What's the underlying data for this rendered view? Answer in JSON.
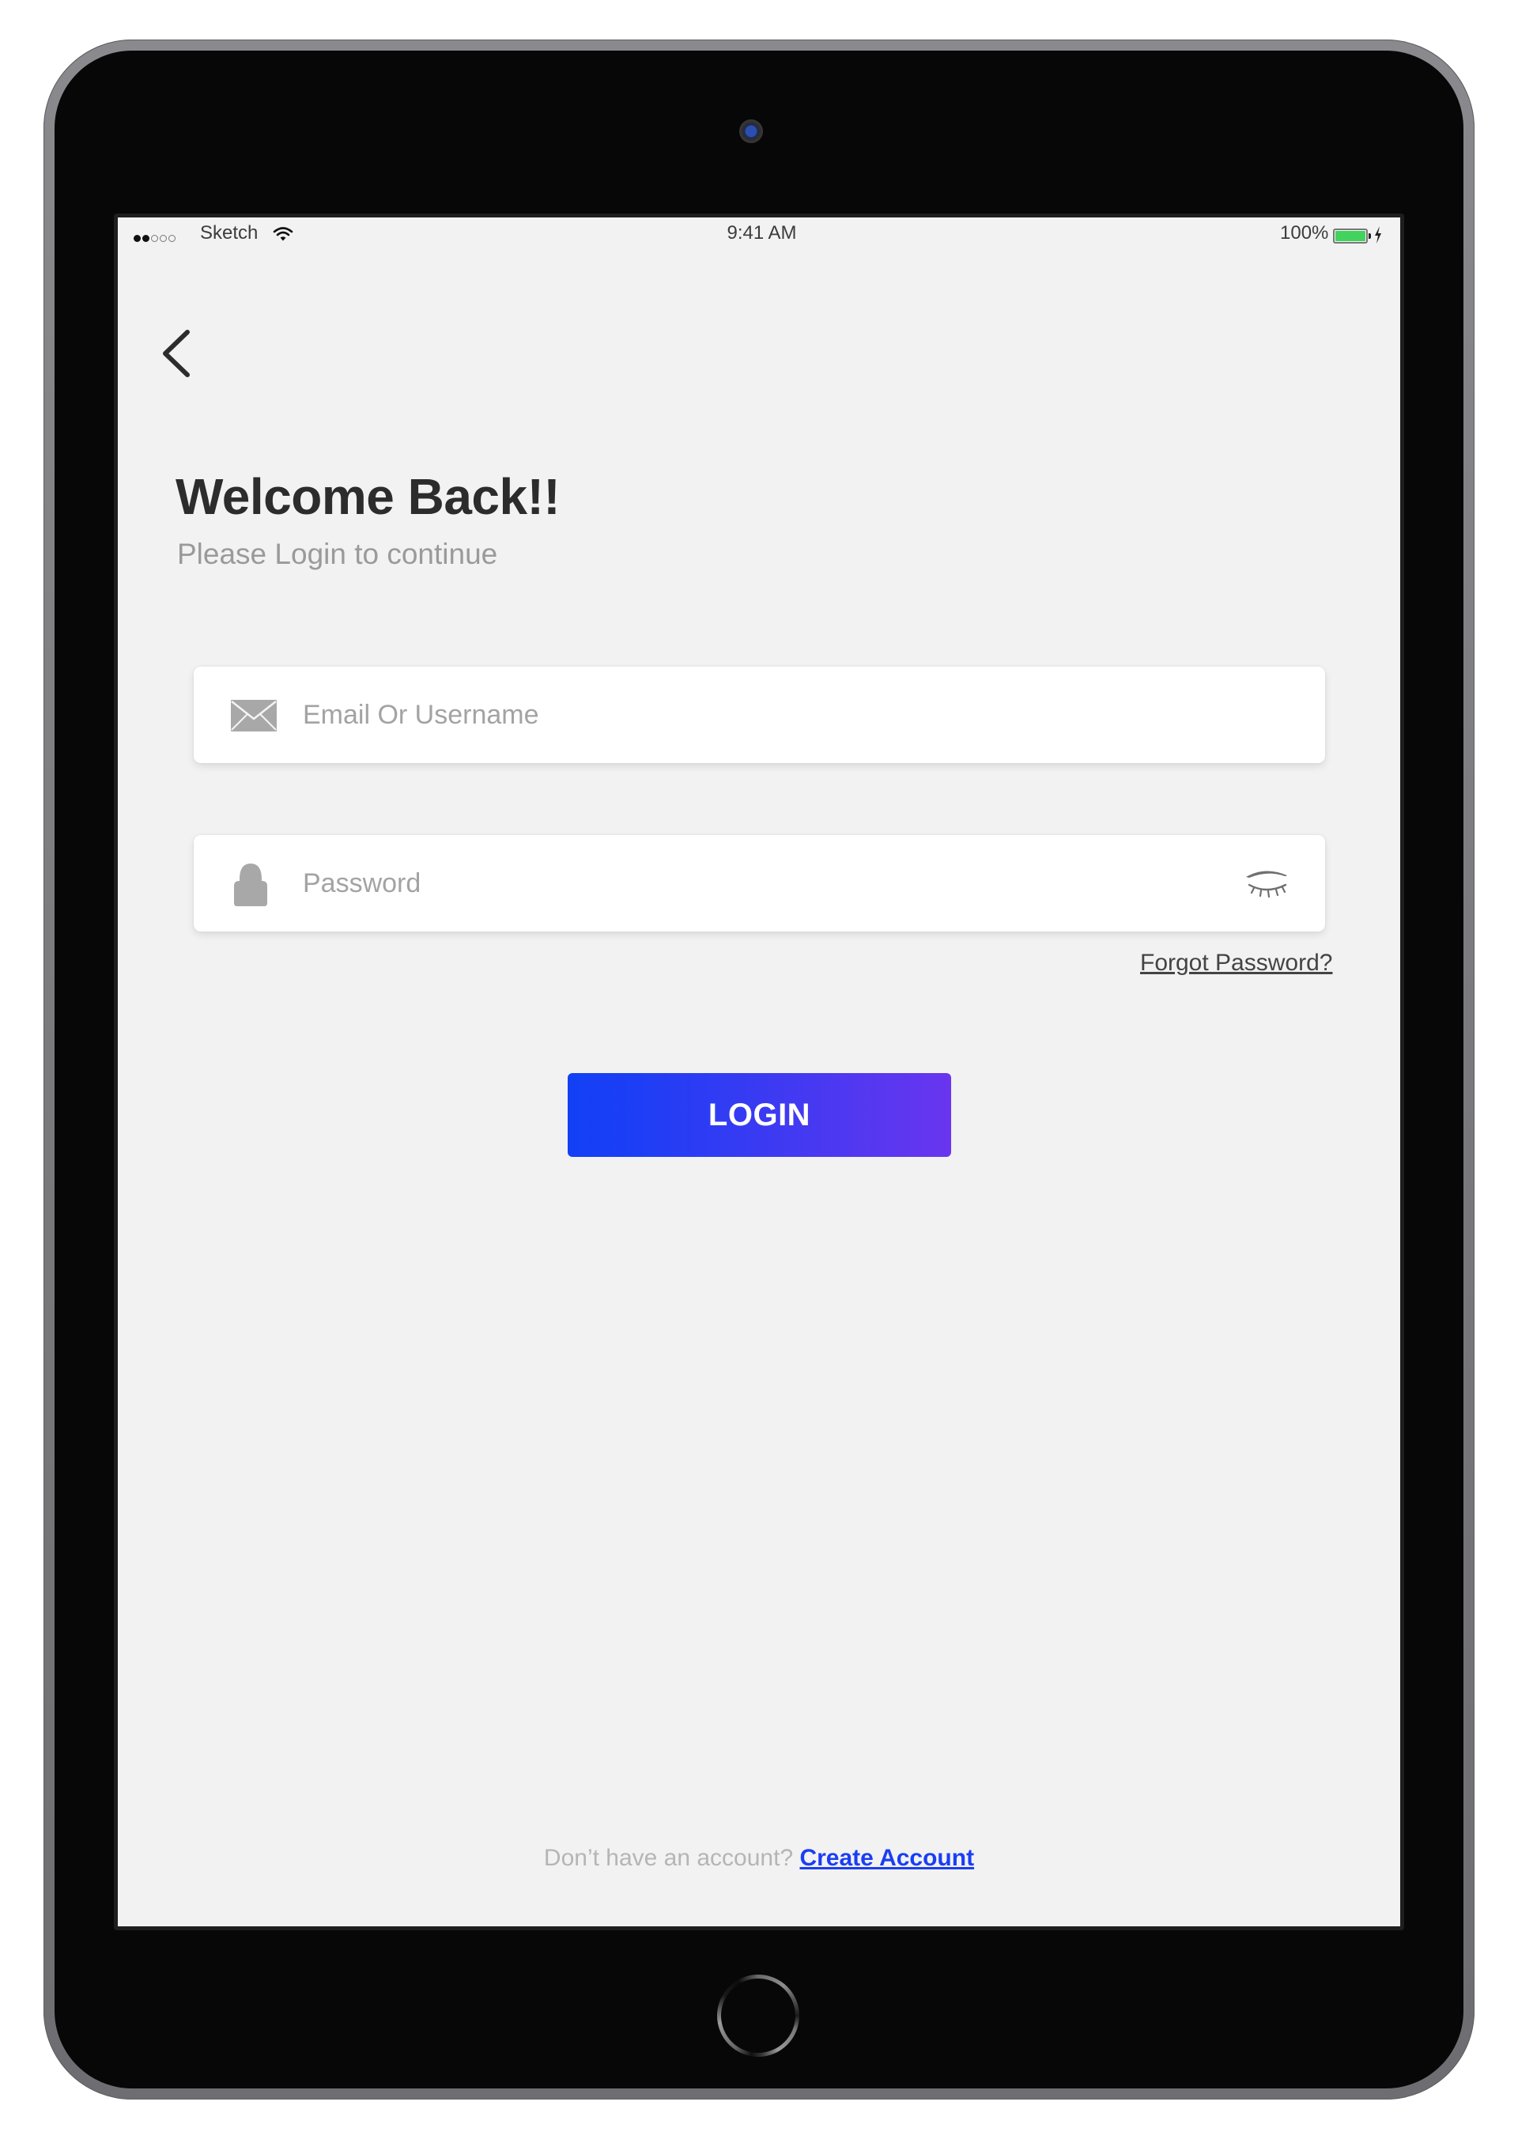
{
  "status_bar": {
    "signal_bars_filled": 2,
    "signal_bars_total": 5,
    "carrier": "Sketch",
    "wifi_icon": "wifi-icon",
    "time": "9:41 AM",
    "battery_percent": "100%",
    "battery_level": 1.0,
    "charging_icon": "bolt-icon"
  },
  "nav": {
    "back_icon": "chevron-left-icon"
  },
  "header": {
    "title": "Welcome Back!!",
    "subtitle": "Please Login to continue"
  },
  "form": {
    "email": {
      "icon": "envelope-icon",
      "placeholder": "Email Or Username",
      "value": ""
    },
    "password": {
      "icon": "lock-icon",
      "placeholder": "Password",
      "value": "",
      "toggle_icon": "eye-closed-icon"
    },
    "forgot_password_label": "Forgot Password?",
    "login_label": "LOGIN"
  },
  "footer": {
    "prompt": "Don’t have an account? ",
    "create_account_label": "Create Account"
  },
  "colors": {
    "accent_start": "#1340f5",
    "accent_end": "#6a35ef",
    "link": "#1a3ef5",
    "background": "#f2f2f2",
    "battery": "#41d35e"
  }
}
